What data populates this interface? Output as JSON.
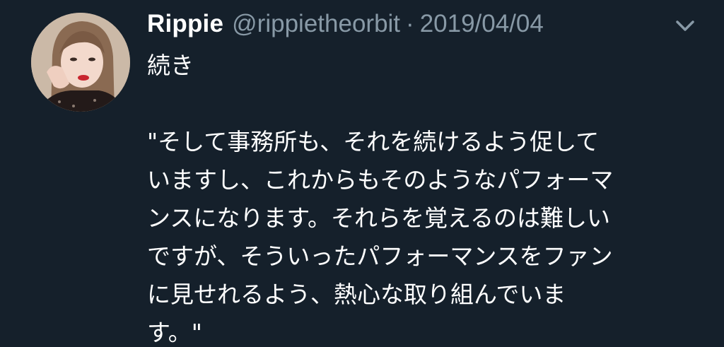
{
  "tweet": {
    "display_name": "Rippie",
    "handle": "@rippietheorbit",
    "separator": "·",
    "date": "2019/04/04",
    "avatar_icon": "profile-photo",
    "menu_icon": "chevron-down-icon",
    "lines": [
      "続き",
      "",
      "\"そして事務所も、それを続けるよう促して",
      "いますし、これからもそのようなパフォーマ",
      "ンスになります。それらを覚えるのは難しい",
      "ですが、そういったパフォーマンスをファン",
      "に見せれるよう、熱心な取り組んでいま",
      "す。\""
    ]
  },
  "colors": {
    "background": "#15202b",
    "primary_text": "#ffffff",
    "secondary_text": "#8899a6"
  }
}
